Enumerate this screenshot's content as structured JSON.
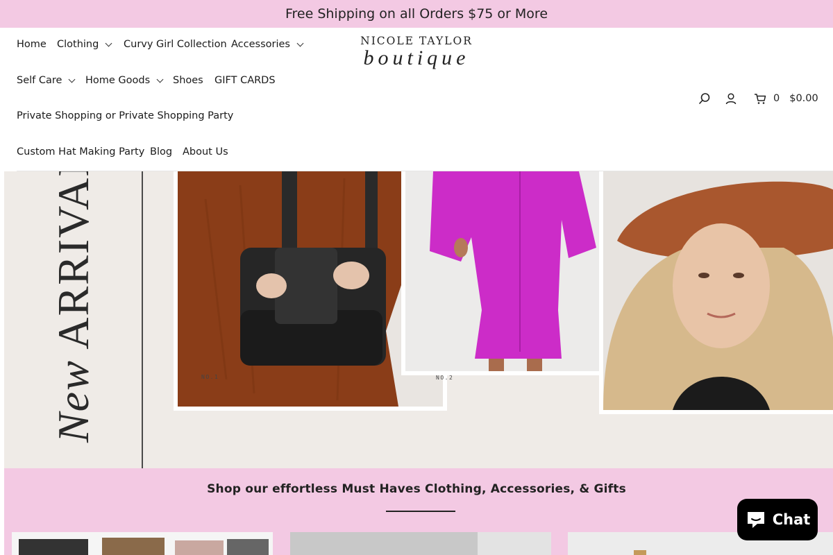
{
  "announcement": "Free Shipping on all Orders $75 or More",
  "nav": {
    "home": "Home",
    "clothing": "Clothing",
    "curvy": "Curvy Girl Collection",
    "accessories": "Accessories",
    "self_care": "Self Care",
    "home_goods": "Home Goods",
    "shoes": "Shoes",
    "gift_cards": "GIFT CARDS",
    "private_shopping": "Private Shopping or Private Shopping Party",
    "hat_party": "Custom Hat Making Party",
    "blog": "Blog",
    "about": "About Us"
  },
  "logo": {
    "top": "NICOLE TAYLOR",
    "bottom": "boutique"
  },
  "header_tools": {
    "search_icon": "search-icon",
    "account_icon": "user-icon",
    "cart_icon": "cart-icon",
    "cart_count": "0",
    "cart_total": "$0.00"
  },
  "hero": {
    "title_script": "New",
    "title_caps": "ARRIVALS",
    "label_1": "NO.1",
    "label_2": "NO.2"
  },
  "promo": {
    "title": "Shop our effortless Must Haves Clothing, Accessories, & Gifts"
  },
  "chat": {
    "label": "Chat",
    "icon": "chat-bubble-icon"
  },
  "colors": {
    "announcement_bg": "#f3c9e3",
    "promo_bg": "#f3c9e3",
    "chat_bg": "#000000"
  }
}
